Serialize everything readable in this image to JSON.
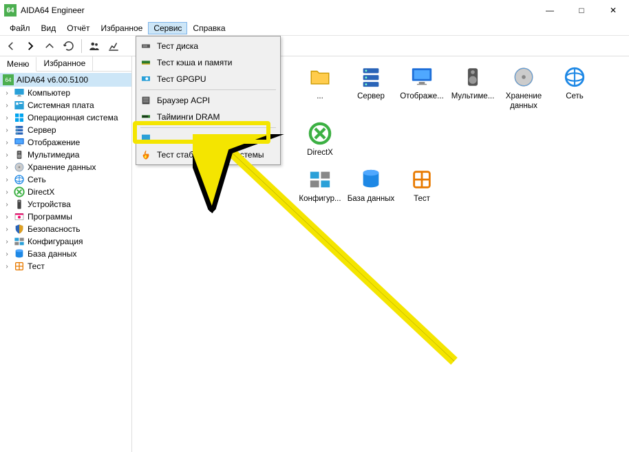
{
  "titlebar": {
    "app_icon_text": "64",
    "title": "AIDA64 Engineer"
  },
  "menubar": {
    "items": [
      {
        "label": "Файл"
      },
      {
        "label": "Вид"
      },
      {
        "label": "Отчёт"
      },
      {
        "label": "Избранное"
      },
      {
        "label": "Сервис",
        "open": true
      },
      {
        "label": "Справка"
      }
    ]
  },
  "side_tabs": {
    "menu": "Меню",
    "favorites": "Избранное"
  },
  "tree": {
    "root_icon_text": "64",
    "root_label": "AIDA64 v6.00.5100",
    "items": [
      {
        "label": "Компьютер",
        "icon": "monitor"
      },
      {
        "label": "Системная плата",
        "icon": "board"
      },
      {
        "label": "Операционная система",
        "icon": "windows"
      },
      {
        "label": "Сервер",
        "icon": "server"
      },
      {
        "label": "Отображение",
        "icon": "display"
      },
      {
        "label": "Мультимедиа",
        "icon": "speaker"
      },
      {
        "label": "Хранение данных",
        "icon": "disk"
      },
      {
        "label": "Сеть",
        "icon": "network"
      },
      {
        "label": "DirectX",
        "icon": "directx"
      },
      {
        "label": "Устройства",
        "icon": "device"
      },
      {
        "label": "Программы",
        "icon": "programs"
      },
      {
        "label": "Безопасность",
        "icon": "shield"
      },
      {
        "label": "Конфигурация",
        "icon": "config"
      },
      {
        "label": "База данных",
        "icon": "database"
      },
      {
        "label": "Тест",
        "icon": "test"
      }
    ]
  },
  "main_icons_row1": [
    {
      "label": "...",
      "icon": "folder",
      "truncated": true
    },
    {
      "label": "Сервер",
      "icon": "server"
    },
    {
      "label": "Отображе...",
      "icon": "display"
    },
    {
      "label": "Мультиме...",
      "icon": "speaker"
    },
    {
      "label": "Хранение данных",
      "icon": "disk"
    },
    {
      "label": "Сеть",
      "icon": "network"
    },
    {
      "label": "DirectX",
      "icon": "directx"
    }
  ],
  "main_icons_row2": [
    {
      "label": "Конфигур...",
      "icon": "config"
    },
    {
      "label": "База данных",
      "icon": "database"
    },
    {
      "label": "Тест",
      "icon": "test"
    }
  ],
  "dropdown": {
    "items": [
      {
        "label": "Тест диска",
        "icon": "disk-test"
      },
      {
        "label": "Тест кэша и памяти",
        "icon": "memory-test"
      },
      {
        "label": "Тест GPGPU",
        "icon": "gpu-test"
      },
      {
        "sep": true
      },
      {
        "label": "Браузер ACPI",
        "icon": "acpi"
      },
      {
        "label": "Тайминги DRAM",
        "icon": "dram"
      },
      {
        "sep": true
      },
      {
        "label": "",
        "icon": "monitor-diag",
        "obscured": true
      },
      {
        "label": "Тест стабильности системы",
        "icon": "flame",
        "highlighted": true
      }
    ]
  }
}
